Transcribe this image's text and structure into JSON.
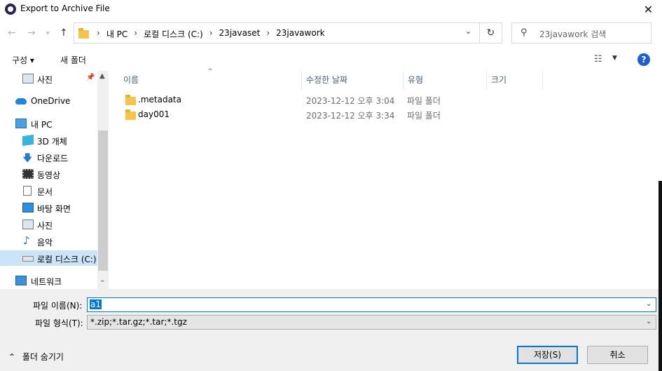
{
  "window": {
    "title": "Export to Archive File",
    "close_glyph": "✕"
  },
  "address": {
    "crumbs": [
      "내 PC",
      "로컬 디스크 (C:)",
      "23javaset",
      "23javawork"
    ],
    "separator": "›",
    "search_placeholder": "23javawork 검색"
  },
  "toolbar": {
    "organize": "구성 ▾",
    "new_folder": "새 폴더",
    "help": "?"
  },
  "nav": {
    "items": [
      {
        "label": "사진",
        "icon": "pictures-icon"
      },
      {
        "label": "OneDrive",
        "icon": "onedrive-icon"
      },
      {
        "label": "내 PC",
        "icon": "this-pc-icon"
      },
      {
        "label": "3D 개체",
        "icon": "3d-objects-icon"
      },
      {
        "label": "다운로드",
        "icon": "downloads-icon"
      },
      {
        "label": "동영상",
        "icon": "videos-icon"
      },
      {
        "label": "문서",
        "icon": "documents-icon"
      },
      {
        "label": "바탕 화면",
        "icon": "desktop-icon"
      },
      {
        "label": "사진",
        "icon": "pictures-icon"
      },
      {
        "label": "음악",
        "icon": "music-icon"
      },
      {
        "label": "로컬 디스크 (C:)",
        "icon": "drive-icon"
      },
      {
        "label": "네트워크",
        "icon": "network-icon"
      }
    ]
  },
  "files": {
    "columns": {
      "name": "이름",
      "date": "수정한 날짜",
      "type": "유형",
      "size": "크기"
    },
    "rows": [
      {
        "name": ".metadata",
        "date": "2023-12-12 오후 3:04",
        "type": "파일 폴더"
      },
      {
        "name": "day001",
        "date": "2023-12-12 오후 3:34",
        "type": "파일 폴더"
      }
    ]
  },
  "form": {
    "filename_label": "파일 이름(N):",
    "filename_value": "a1",
    "filetype_label": "파일 형식(T):",
    "filetype_value": "*.zip;*.tar.gz;*.tar;*.tgz",
    "hide_folders": "폴더 숨기기",
    "save": "저장(S)",
    "cancel": "취소"
  }
}
